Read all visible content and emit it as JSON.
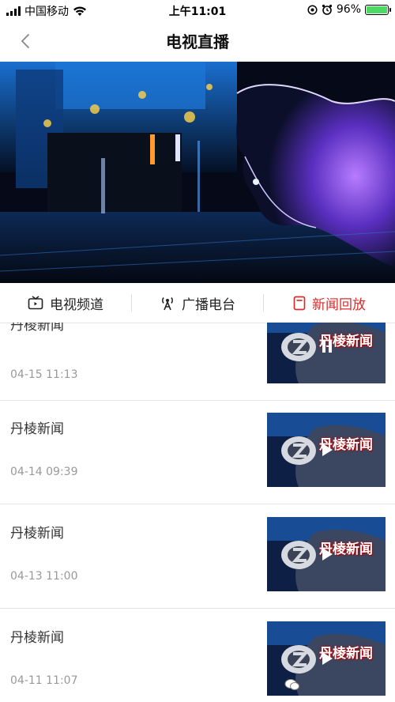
{
  "status_bar": {
    "carrier": "中国移动",
    "time": "上午11:01",
    "battery": "96%"
  },
  "navbar": {
    "title": "电视直播"
  },
  "tabs": [
    {
      "label": "电视频道",
      "icon": "tv-icon",
      "active": false
    },
    {
      "label": "广播电台",
      "icon": "radio-tower-icon",
      "active": false
    },
    {
      "label": "新闻回放",
      "icon": "document-icon",
      "active": true
    }
  ],
  "list": {
    "items": [
      {
        "title": "丹棱新闻",
        "time": "04-15 11:13",
        "thumb_label": "丹棱新闻",
        "playing": true
      },
      {
        "title": "丹棱新闻",
        "time": "04-14 09:39",
        "thumb_label": "丹棱新闻",
        "playing": false
      },
      {
        "title": "丹棱新闻",
        "time": "04-13 11:00",
        "thumb_label": "丹棱新闻",
        "playing": false
      },
      {
        "title": "丹棱新闻",
        "time": "04-11 11:07",
        "thumb_label": "丹棱新闻",
        "playing": false
      }
    ]
  },
  "colors": {
    "accent": "#d92c2c",
    "battery": "#4cd964"
  }
}
